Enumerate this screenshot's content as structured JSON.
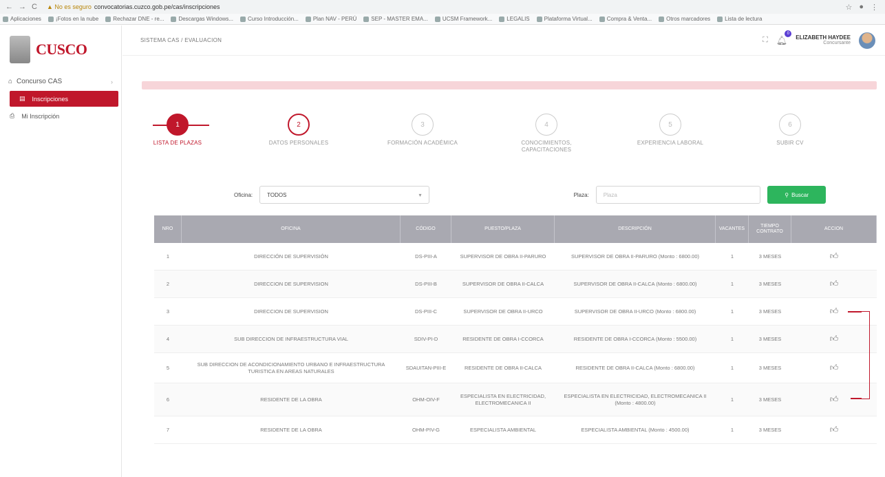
{
  "browser": {
    "nav": [
      "←",
      "→",
      "C"
    ],
    "security": "▲ No es seguro",
    "url": "convocatorias.cuzco.gob.pe/cas/inscripciones",
    "bookmarks": [
      "Aplicaciones",
      "¡Fotos en la nube",
      "Rechazar DNE - re...",
      "Descargas Windows...",
      "Curso Introducción...",
      "Plan NAV - PERÚ",
      "SEP - MASTER EMA...",
      "UCSM Framework...",
      "LEGALIS",
      "Plataforma Virtual...",
      "Compra & Venta...",
      "Otros marcadores",
      "Lista de lectura"
    ]
  },
  "sidebar": {
    "logo_text": "CUSCO",
    "section": "Concurso CAS",
    "items": [
      {
        "label": "Inscripciones",
        "active": true
      },
      {
        "label": "Mi Inscripción",
        "active": false
      }
    ]
  },
  "topbar": {
    "breadcrumb": "SISTEMA CAS / EVALUACION",
    "notification_count": "0",
    "user_name": "ELIZABETH HAYDEE",
    "user_role": "Concursante"
  },
  "stepper": [
    {
      "n": "1",
      "label": "LISTA DE PLAZAS",
      "state": "active"
    },
    {
      "n": "2",
      "label": "DATOS PERSONALES",
      "state": "next"
    },
    {
      "n": "3",
      "label": "FORMACIÓN ACADÉMICA",
      "state": "pending"
    },
    {
      "n": "4",
      "label": "CONOCIMIENTOS, CAPACITACIONES",
      "state": "pending"
    },
    {
      "n": "5",
      "label": "EXPERIENCIA LABORAL",
      "state": "pending"
    },
    {
      "n": "6",
      "label": "SUBIR CV",
      "state": "pending"
    }
  ],
  "filters": {
    "oficina_label": "Oficina:",
    "oficina_value": "TODOS",
    "plaza_label": "Plaza:",
    "plaza_placeholder": "Plaza",
    "search_button": "Buscar"
  },
  "table": {
    "headers": [
      "NRO",
      "OFICINA",
      "CÓDIGO",
      "PUESTO/PLAZA",
      "DESCRIPCIÓN",
      "VACANTES",
      "TIEMPO CONTRATO",
      "ACCION"
    ],
    "rows": [
      [
        "1",
        "DIRECCIÓN DE SUPERVISIÓN",
        "DS-PIII-A",
        "SUPERVISOR DE OBRA II-PARURO",
        "SUPERVISOR DE OBRA II-PARURO (Monto : 6800.00)",
        "1",
        "3 MESES"
      ],
      [
        "2",
        "DIRECCION DE SUPERVISION",
        "DS-PIII-B",
        "SUPERVISOR DE OBRA II-CALCA",
        "SUPERVISOR DE OBRA II-CALCA (Monto : 6800.00)",
        "1",
        "3 MESES"
      ],
      [
        "3",
        "DIRECCION DE SUPERVISION",
        "DS-PIII-C",
        "SUPERVISOR DE OBRA II-URCO",
        "SUPERVISOR DE OBRA II-URCO (Monto : 6800.00)",
        "1",
        "3 MESES"
      ],
      [
        "4",
        "SUB DIRECCION DE INFRAESTRUCTURA VIAL",
        "SDIV-PI-D",
        "RESIDENTE DE OBRA I-CCORCA",
        "RESIDENTE DE OBRA I-CCORCA (Monto : 5500.00)",
        "1",
        "3 MESES"
      ],
      [
        "5",
        "SUB DIRECCION DE ACONDICIONAMIENTO URBANO E INFRAESTRUCTURA TURISTICA EN AREAS NATURALES",
        "SDAUITAN-PIII-E",
        "RESIDENTE DE OBRA II-CALCA",
        "RESIDENTE DE OBRA II-CALCA (Monto : 6800.00)",
        "1",
        "3 MESES"
      ],
      [
        "6",
        "RESIDENTE DE LA OBRA",
        "OHM-OIV-F",
        "ESPECIALISTA EN ELECTRICIDAD, ELECTROMECANICA II",
        "ESPECIALISTA EN ELECTRICIDAD, ELECTROMECANICA II (Monto : 4800.00)",
        "1",
        "3 MESES"
      ],
      [
        "7",
        "RESIDENTE DE LA OBRA",
        "OHM-PIV-G",
        "ESPECIALISTA AMBIENTAL",
        "ESPECIALISTA AMBIENTAL (Monto : 4500.00)",
        "1",
        "3 MESES"
      ]
    ]
  },
  "colors": {
    "brand": "#c0172b",
    "header": "#a9a9b1",
    "success": "#2db55d"
  }
}
